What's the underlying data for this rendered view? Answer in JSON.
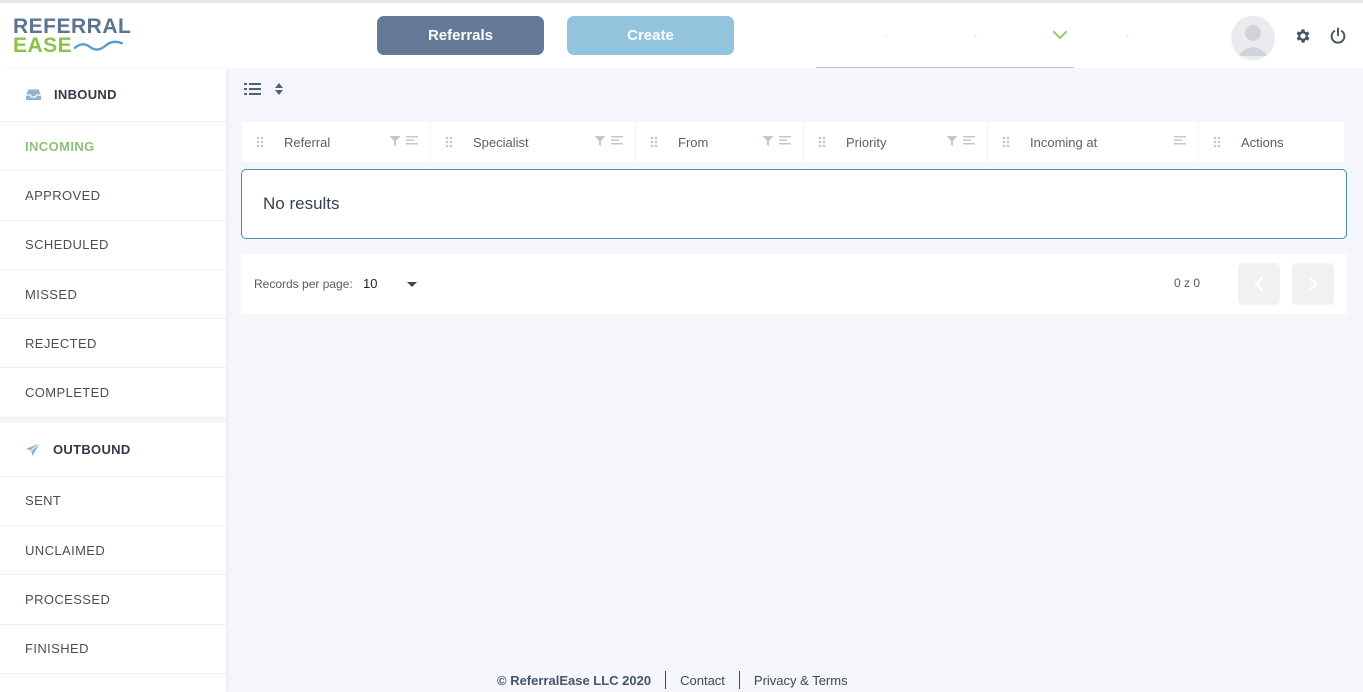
{
  "header": {
    "logo_line1": "REFERRAL",
    "logo_line2": "EASE",
    "referrals_label": "Referrals",
    "create_label": "Create"
  },
  "sidebar": {
    "inbound": {
      "title": "INBOUND",
      "items": [
        "INCOMING",
        "APPROVED",
        "SCHEDULED",
        "MISSED",
        "REJECTED",
        "COMPLETED"
      ],
      "active": "INCOMING"
    },
    "outbound": {
      "title": "OUTBOUND",
      "items": [
        "SENT",
        "UNCLAIMED",
        "PROCESSED",
        "FINISHED"
      ]
    }
  },
  "table": {
    "columns": [
      "Referral",
      "Specialist",
      "From",
      "Priority",
      "Incoming at",
      "Actions"
    ],
    "empty_text": "No results"
  },
  "pagination": {
    "records_label": "Records per page:",
    "records_value": "10",
    "count": "0 z 0"
  },
  "footer": {
    "copyright": "© ReferralEase LLC 2020",
    "contact": "Contact",
    "privacy": "Privacy & Terms"
  },
  "colors": {
    "primary": "#647996",
    "create": "#92c5dd",
    "accent_green": "#8ec07a",
    "empty_border": "#4e8fa3"
  },
  "icons": [
    "inbox-icon",
    "paper-plane-icon",
    "list-icon",
    "sort-icon",
    "filter-icon",
    "align-icon",
    "drag-handle-icon",
    "chevron-down-icon",
    "gear-icon",
    "power-icon",
    "avatar-icon",
    "chevron-left-icon",
    "chevron-right-icon"
  ]
}
